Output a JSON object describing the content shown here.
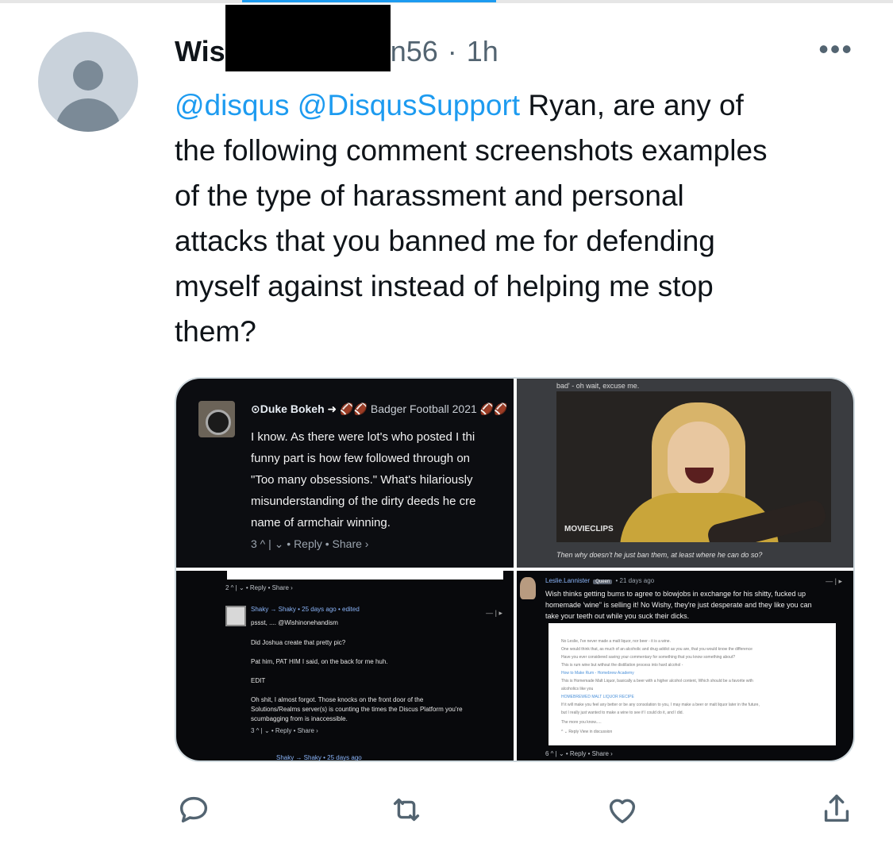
{
  "tweet": {
    "display_name_visible": "Wis",
    "handle_visible": "n56",
    "separator": "·",
    "timestamp": "1h",
    "more_label": "•••",
    "mentions": [
      "@disqus",
      "@DisqusSupport"
    ],
    "text_lines": [
      "Ryan, are any of",
      "the following comment screenshots examples",
      "of the type of harassment and personal",
      "attacks that you banned me for defending",
      "myself against instead of helping me stop",
      "them?"
    ]
  },
  "media": {
    "tile1": {
      "username": "⊙Duke Bokeh",
      "group": "Badger Football 2021",
      "lines": [
        "I know. As there were lot's who posted I thi",
        "funny part is how few followed through on",
        "\"Too many obsessions.\" What's hilariously",
        "misunderstanding of the dirty deeds he cre",
        "name of armchair winning."
      ],
      "actions": "3 ^ | ⌄ • Reply • Share ›"
    },
    "tile2": {
      "caption_top": "bad' - oh wait, excuse me.",
      "logo": "MOVIECLIPS",
      "caption_bottom": "Then why doesn't he just ban them, at least where he can do so?"
    },
    "tile3": {
      "top_actions": "2 ^ | ⌄ • Reply • Share ›",
      "username": "Shaky → Shaky • 25 days ago • edited",
      "lines": [
        "pssst, .... @Wishinonehandism",
        "Did Joshua create that pretty pic?",
        "Pat him, PAT HIM I said, on the back for me huh.",
        "EDIT",
        "Oh shit, I almost forgot. Those knocks on the front door of the",
        "Solutions/Realms server(s) is counting the times the Discus Platform you're",
        "scumbagging from is inaccessible."
      ],
      "actions": "3 ^ | ⌄ • Reply • Share ›",
      "next_username": "Shaky → Shaky • 25 days ago"
    },
    "tile4": {
      "username": "Leslie.Lannister",
      "badge": "Queen",
      "age": "• 21 days ago",
      "lines": [
        "Wish thinks getting bums to agree to blowjobs in exchange for his shitty, fucked up",
        "homemade 'wine\" is selling it! No Wishy, they're just desperate and they like you can",
        "take your teeth out while you suck their dicks."
      ],
      "card_lines": [
        "No Leslie, I've never made a malt liquor, nor beer - it is a wine.",
        "One would think that, as much of an alcoholic and drug addict as you are, that you would know the difference",
        "Have you ever considered saving your commentary for something that you know something about?",
        "This is rum wine but without the distillation process into hard alcohol -",
        "How to Make Rum - Homebrew Academy",
        "This is Homemade Malt Liquor, basically a beer with a higher alcohol content, Which should be a favorite with",
        "alcoholics like you",
        "HOMEBREWED MALT LIQUOR RECIPE",
        "If it will make you feel any better or be any consolation to you, I may make a beer or malt liquor later in the future,",
        "but I really just wanted to make a wine to see if I could do it, and I did.",
        "The more you know.....",
        "^ ⌄ Reply View in discussion"
      ],
      "actions": "6 ^ | ⌄ • Reply • Share ›"
    }
  },
  "colors": {
    "link": "#1d9bf0",
    "text": "#0f1419",
    "muted": "#536471"
  },
  "icons": [
    "reply-icon",
    "retweet-icon",
    "like-icon",
    "share-icon"
  ]
}
